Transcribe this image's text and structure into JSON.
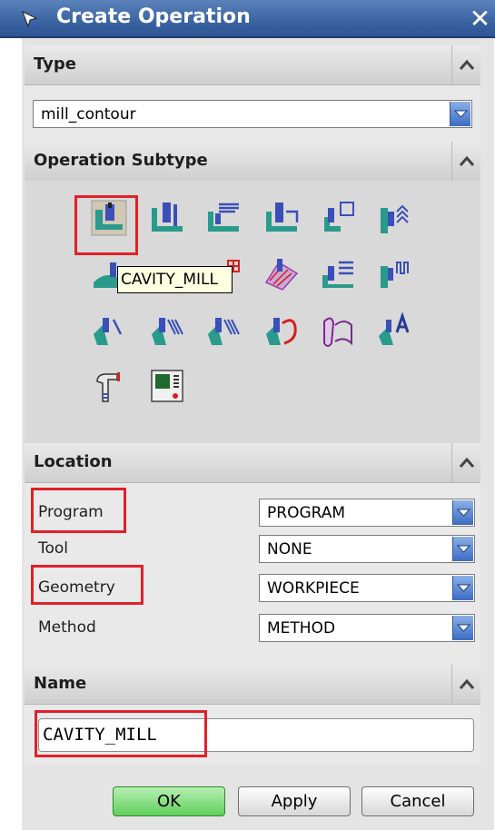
{
  "window": {
    "title": "Create Operation",
    "close_glyph": "✕"
  },
  "type_section": {
    "header": "Type",
    "selected": "mill_contour"
  },
  "subtype_section": {
    "header": "Operation Subtype",
    "tooltip": "CAVITY_MILL",
    "icons": [
      "cavity-mill-icon",
      "plunge-milling-icon",
      "corner-rough-icon",
      "rest-milling-icon",
      "zlevel-profile-icon",
      "zlevel-corner-icon",
      "fixed-contour-icon",
      "contour-area-icon",
      "contour-surface-area-icon",
      "streamline-icon",
      "contour-area-non-steep-icon",
      "contour-area-dir-steep-icon",
      "flowcut-single-icon",
      "flowcut-multiple-icon",
      "flowcut-ref-tool-icon",
      "flowcut-smooth-icon",
      "solid-profile-3d-icon",
      "contour-text-icon",
      "mill-user-icon",
      "mill-control-icon"
    ]
  },
  "location_section": {
    "header": "Location",
    "fields": [
      {
        "label": "Program",
        "value": "PROGRAM"
      },
      {
        "label": "Tool",
        "value": "NONE"
      },
      {
        "label": "Geometry",
        "value": "WORKPIECE"
      },
      {
        "label": "Method",
        "value": "METHOD"
      }
    ]
  },
  "name_section": {
    "header": "Name",
    "value": "CAVITY_MILL"
  },
  "buttons": {
    "ok": "OK",
    "apply": "Apply",
    "cancel": "Cancel"
  },
  "colors": {
    "titlebar": "#3a63a2",
    "highlight": "#e0202a",
    "ok_button": "#5fcf5b",
    "dropdown": "#3c6cc4"
  }
}
